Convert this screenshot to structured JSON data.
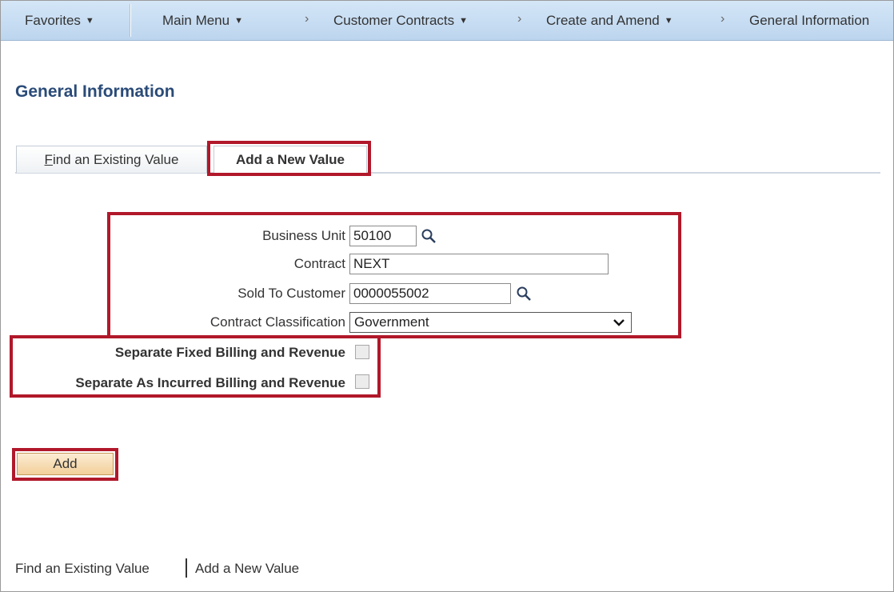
{
  "nav": {
    "favorites": "Favorites",
    "main_menu": "Main Menu",
    "customer_contracts": "Customer Contracts",
    "create_and_amend": "Create and Amend",
    "general_information": "General Information"
  },
  "page_title": "General Information",
  "tabs": {
    "find_first_letter": "F",
    "find_rest": "ind an Existing Value",
    "add_new": "Add a New Value"
  },
  "form": {
    "business_unit_label": "Business Unit",
    "business_unit_value": "50100",
    "contract_label": "Contract",
    "contract_value": "NEXT",
    "sold_to_customer_label": "Sold To Customer",
    "sold_to_customer_value": "0000055002",
    "contract_classification_label": "Contract Classification",
    "contract_classification_value": "Government",
    "separate_fixed_label": "Separate Fixed Billing and Revenue",
    "separate_fixed_checked": false,
    "separate_incurred_label": "Separate As Incurred Billing and Revenue",
    "separate_incurred_checked": false
  },
  "add_button_label": "Add",
  "footer": {
    "find_link": "Find an Existing Value",
    "add_link": "Add a New Value"
  },
  "colors": {
    "highlight": "#b1182a",
    "nav_bar": "#c8ddf3",
    "title": "#2a4b78"
  },
  "icons": {
    "lookup": "magnifier-icon",
    "dropdown": "chevron-down-icon",
    "menu_caret": "caret-down-icon",
    "breadcrumb_separator": "chevron-right-icon"
  }
}
